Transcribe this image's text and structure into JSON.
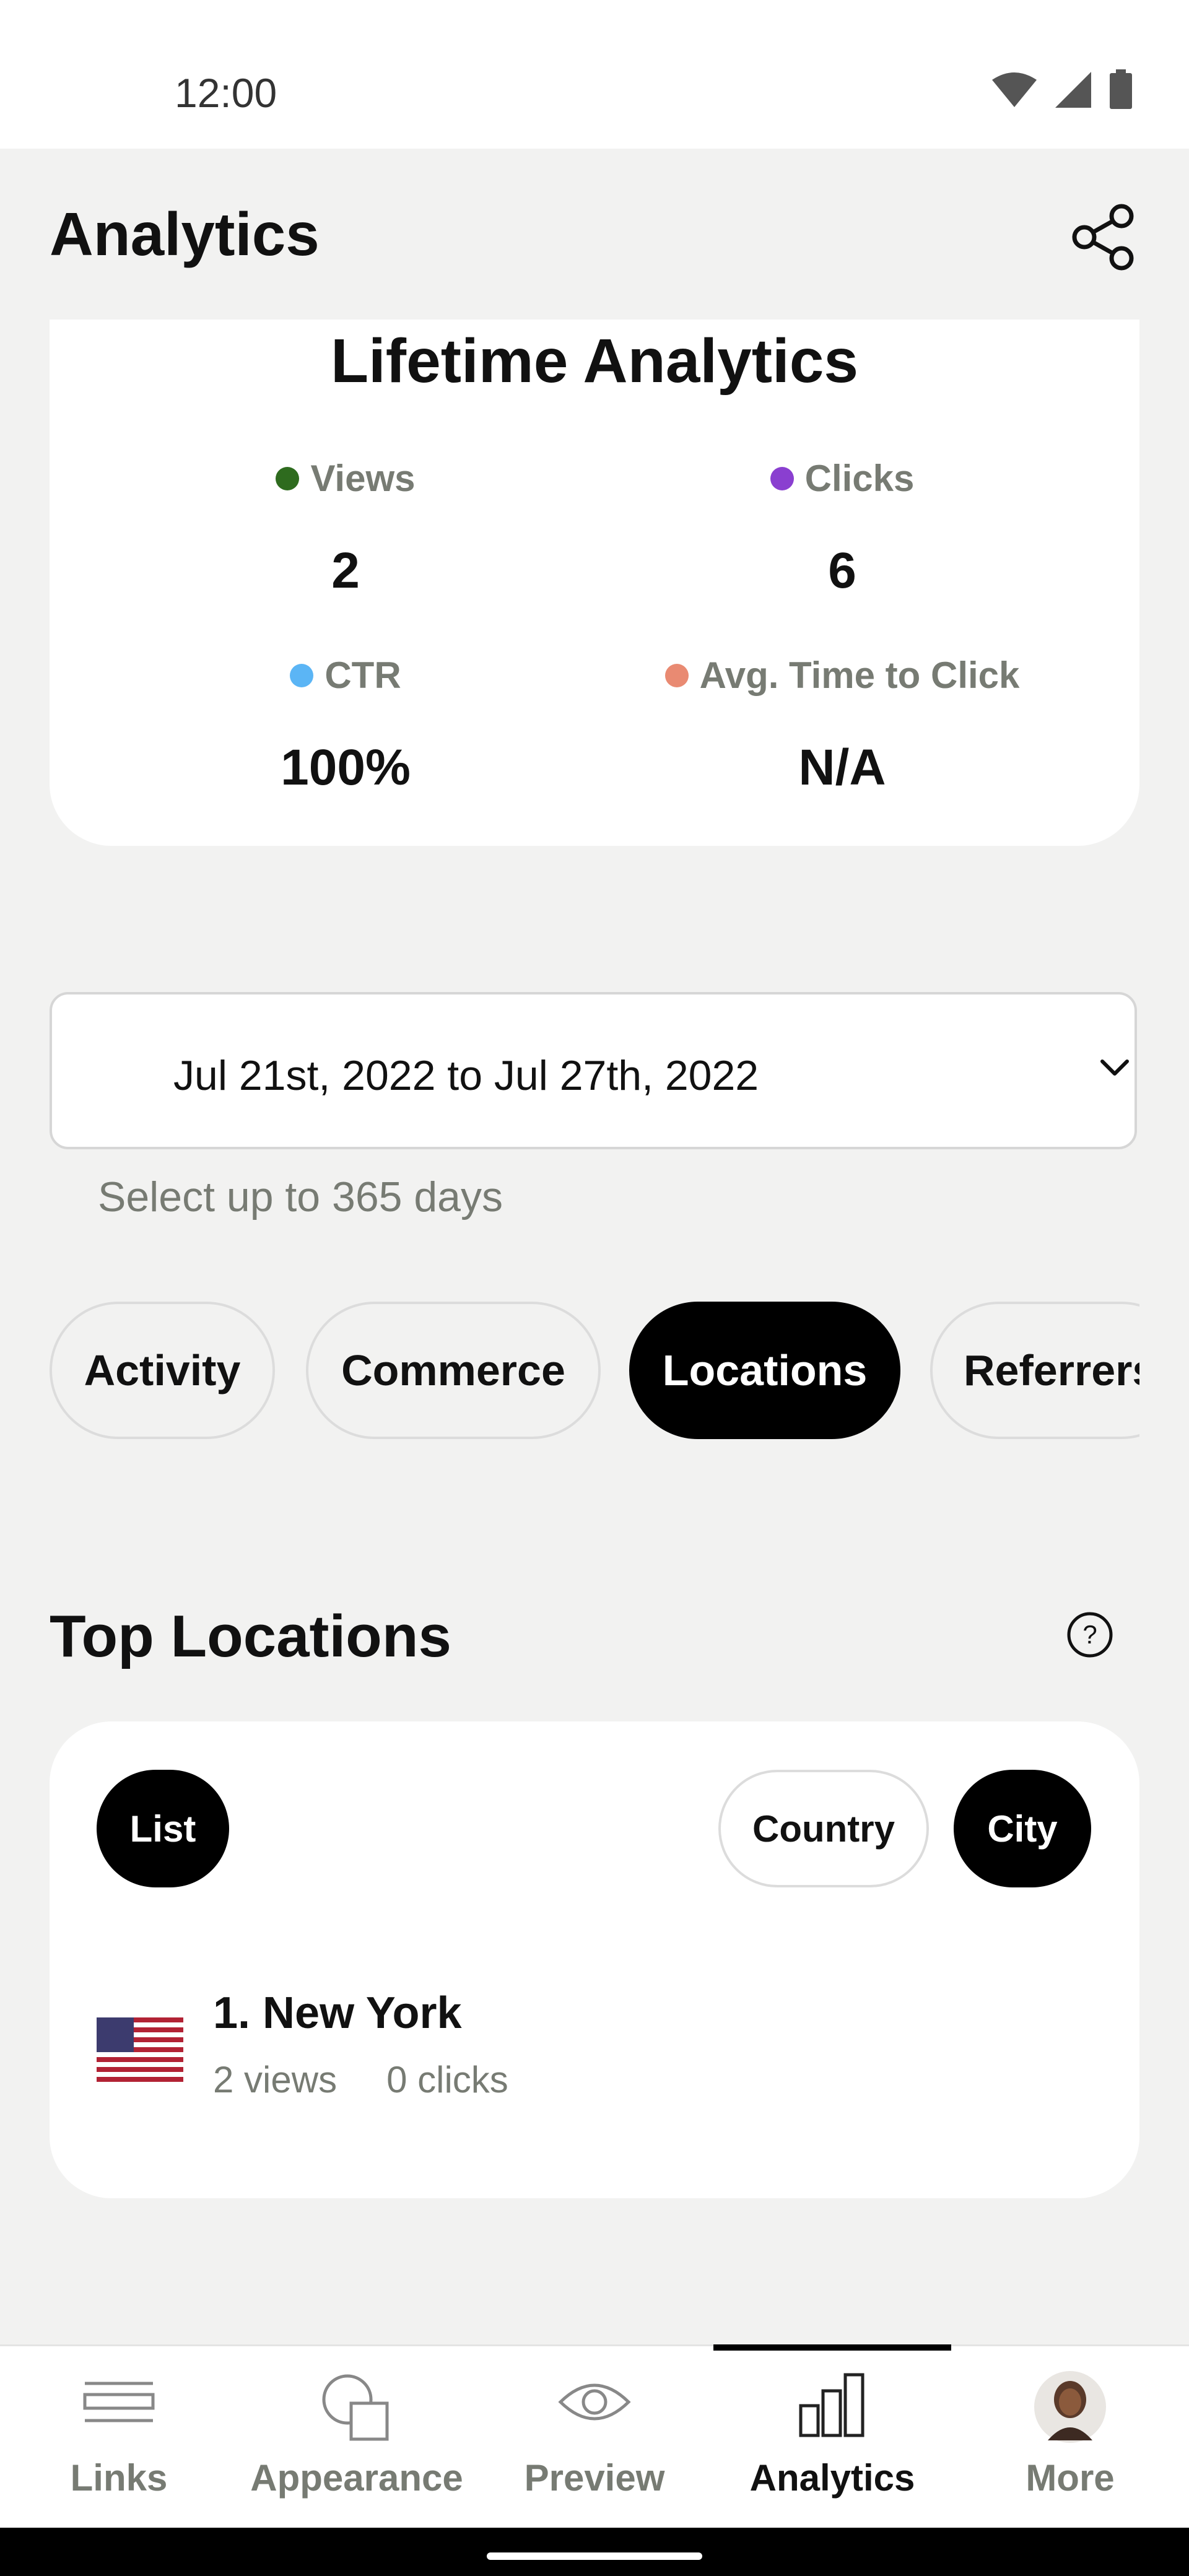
{
  "status_bar": {
    "time": "12:00"
  },
  "header": {
    "title": "Analytics"
  },
  "lifetime": {
    "title": "Lifetime Analytics",
    "metrics": [
      {
        "label": "Views",
        "value": "2",
        "color": "#2e6b1e"
      },
      {
        "label": "Clicks",
        "value": "6",
        "color": "#8a3fd0"
      },
      {
        "label": "CTR",
        "value": "100%",
        "color": "#5bb5f5"
      },
      {
        "label": "Avg. Time to Click",
        "value": "N/A",
        "color": "#e98a72"
      }
    ]
  },
  "date_range": {
    "value": "Jul 21st, 2022 to Jul 27th, 2022",
    "hint": "Select up to 365 days"
  },
  "tabs": [
    {
      "label": "Activity",
      "active": false
    },
    {
      "label": "Commerce",
      "active": false
    },
    {
      "label": "Locations",
      "active": true
    },
    {
      "label": "Referrers",
      "active": false
    }
  ],
  "top_locations": {
    "title": "Top Locations",
    "view_mode": "List",
    "filters": [
      {
        "label": "Country",
        "selected": false
      },
      {
        "label": "City",
        "selected": true
      }
    ],
    "items": [
      {
        "rank_name": "1. New York",
        "views": "2 views",
        "clicks": "0 clicks",
        "flag": "us-flag"
      }
    ]
  },
  "bottom_nav": {
    "items": [
      {
        "label": "Links",
        "icon": "links-icon",
        "active": false
      },
      {
        "label": "Appearance",
        "icon": "appearance-icon",
        "active": false
      },
      {
        "label": "Preview",
        "icon": "eye-icon",
        "active": false
      },
      {
        "label": "Analytics",
        "icon": "bar-chart-icon",
        "active": true
      },
      {
        "label": "More",
        "icon": "avatar",
        "active": false
      }
    ]
  }
}
